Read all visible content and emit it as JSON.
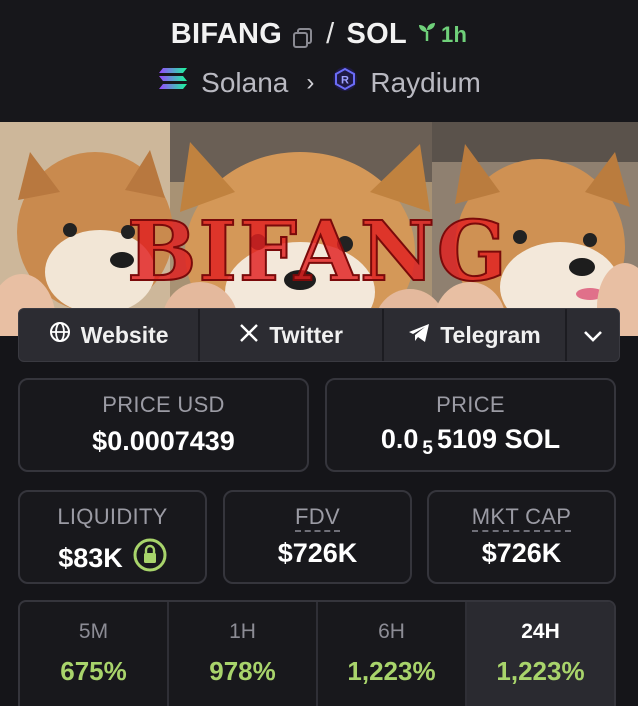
{
  "header": {
    "token": "BIFANG",
    "quote": "SOL",
    "age": "1h",
    "chain": "Solana",
    "dex": "Raydium",
    "icons": {
      "copy": "copy-icon",
      "age": "sprout-icon",
      "chain": "solana-logo",
      "dex": "raydium-logo"
    }
  },
  "banner": {
    "overlay_text": "BIFANG"
  },
  "links": [
    {
      "label": "Website",
      "icon": "globe-icon"
    },
    {
      "label": "Twitter",
      "icon": "x-logo-icon"
    },
    {
      "label": "Telegram",
      "icon": "telegram-icon"
    }
  ],
  "price_usd": {
    "label": "PRICE USD",
    "value": "$0.0007439"
  },
  "price": {
    "label": "PRICE",
    "prefix": "0.0",
    "zeros": "5",
    "digits": "5109",
    "unit": "SOL"
  },
  "liquidity": {
    "label": "LIQUIDITY",
    "value": "$83K",
    "icon": "lock-icon"
  },
  "fdv": {
    "label": "FDV",
    "value": "$726K"
  },
  "mktcap": {
    "label": "MKT CAP",
    "value": "$726K"
  },
  "stats": [
    {
      "label": "5M",
      "value": "675%"
    },
    {
      "label": "1H",
      "value": "978%"
    },
    {
      "label": "6H",
      "value": "1,223%"
    },
    {
      "label": "24H",
      "value": "1,223%",
      "active": true
    }
  ],
  "colors": {
    "positive": "#a8d46b",
    "age": "#6fd07a",
    "lock": "#a8d46b"
  }
}
